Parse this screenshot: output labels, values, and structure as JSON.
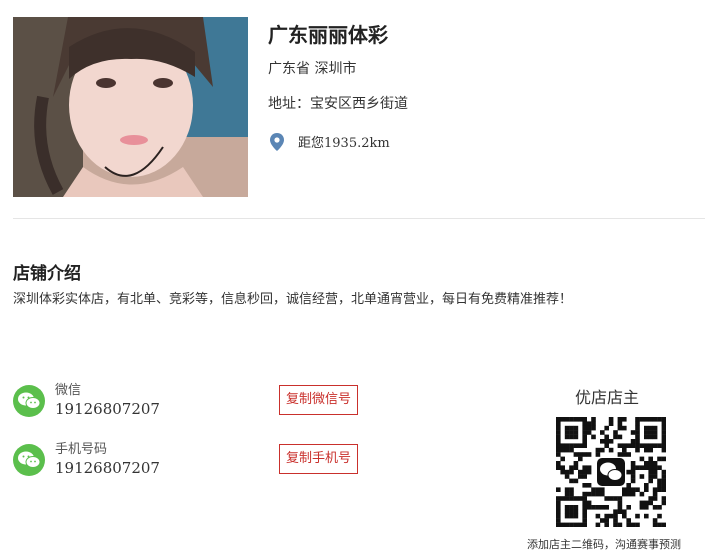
{
  "shop": {
    "name": "广东丽丽体彩",
    "region": "广东省 深圳市",
    "address": "地址：宝安区西乡街道",
    "distance": "距您1935.2km"
  },
  "intro": {
    "title": "店铺介绍",
    "text": "深圳体彩实体店，有北单、竞彩等，信息秒回，诚信经营，北单通宵营业，每日有免费精准推荐！"
  },
  "contacts": [
    {
      "label": "微信",
      "value": "19126807207",
      "button": "复制微信号",
      "icon": "wechat-icon"
    },
    {
      "label": "手机号码",
      "value": "19126807207",
      "button": "复制手机号",
      "icon": "wechat-icon"
    }
  ],
  "qr": {
    "title": "优店店主",
    "caption": "添加店主二维码，沟通赛事预测"
  },
  "colors": {
    "accent_red": "#c9302c",
    "wechat_green": "#5bbf4c",
    "pin_blue": "#5b86b5"
  }
}
